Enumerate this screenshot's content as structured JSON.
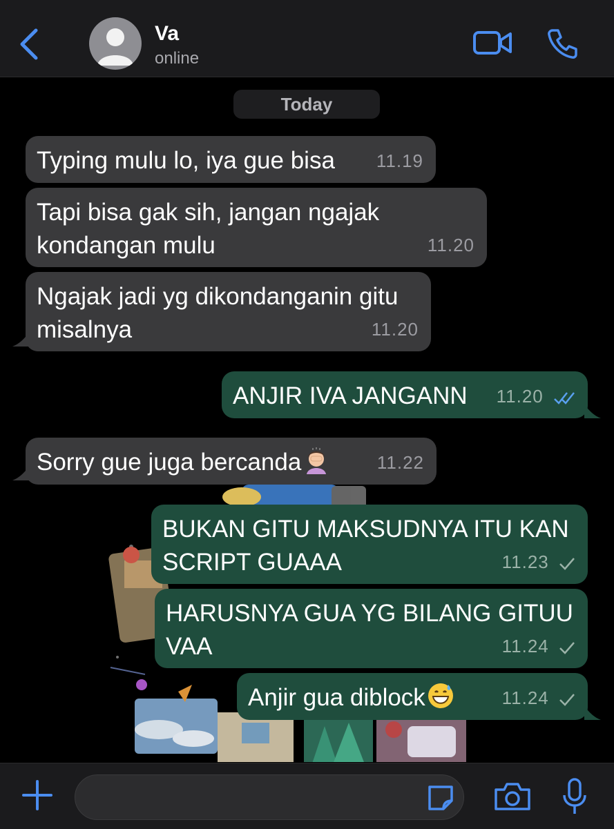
{
  "header": {
    "contact_name": "Va",
    "status": "online"
  },
  "chat": {
    "date_label": "Today",
    "messages": [
      {
        "direction": "incoming",
        "text": "Typing mulu lo, iya gue bisa",
        "time": "11.19"
      },
      {
        "direction": "incoming",
        "text": "Tapi bisa gak sih, jangan ngajak kondangan mulu",
        "time": "11.20"
      },
      {
        "direction": "incoming",
        "text": "Ngajak jadi yg dikondanganin gitu misalnya",
        "time": "11.20"
      },
      {
        "direction": "outgoing",
        "text": "ANJIR IVA JANGANN",
        "time": "11.20",
        "receipt": "read"
      },
      {
        "direction": "incoming",
        "text": "Sorry gue juga bercanda",
        "time": "11.22",
        "emoji": "woman-facepalming-emoji"
      },
      {
        "direction": "outgoing",
        "text": "BUKAN GITU MAKSUDNYA ITU KAN SCRIPT GUAAA",
        "time": "11.23",
        "receipt": "sent"
      },
      {
        "direction": "outgoing",
        "text": "HARUSNYA GUA YG BILANG GITUU VAA",
        "time": "11.24",
        "receipt": "sent"
      },
      {
        "direction": "outgoing",
        "text": "Anjir gua diblock",
        "time": "11.24",
        "receipt": "sent",
        "emoji": "grinning-sweat-emoji"
      }
    ]
  },
  "icons": {
    "back": "chevron-left-icon",
    "video": "video-camera-icon",
    "phone": "phone-icon",
    "plus": "plus-icon",
    "sticker": "sticker-icon",
    "camera": "camera-icon",
    "mic": "microphone-icon"
  },
  "colors": {
    "accent": "#4b8df0",
    "incoming_bubble": "#3a3a3c",
    "outgoing_bubble": "#1f4d3d",
    "read_tick": "#5aa0f0"
  }
}
